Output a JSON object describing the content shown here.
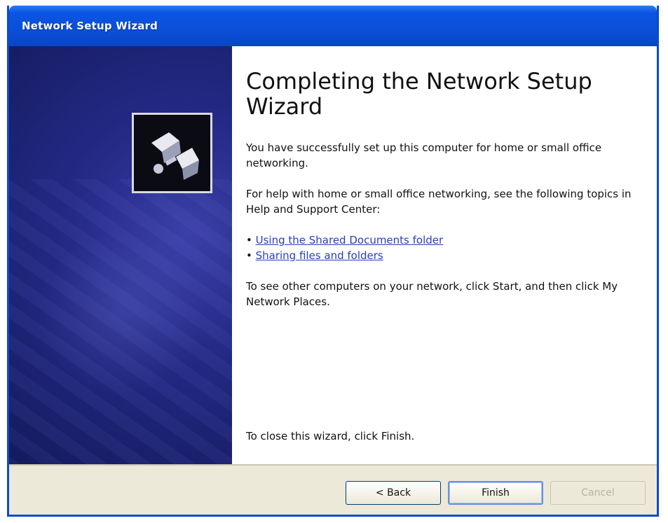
{
  "window": {
    "title": "Network Setup Wizard"
  },
  "icons": {
    "sidebar_graphic": "network-setup-wizard-icon"
  },
  "content": {
    "heading": "Completing the Network Setup Wizard",
    "para1": "You have successfully set up this computer for home or small office networking.",
    "para2": "For help with home or small office networking, see the following topics in Help and Support Center:",
    "links": [
      "Using the Shared Documents folder",
      "Sharing files and folders"
    ],
    "para3": "To see other computers on your network, click Start, and then click My Network Places.",
    "finish_note": "To close this wizard, click Finish."
  },
  "buttons": {
    "back": "< Back",
    "finish": "Finish",
    "cancel": "Cancel"
  },
  "colors": {
    "title_bar": "#0a4fd8",
    "sidebar": "#242a86",
    "link": "#2a3fb3",
    "footer": "#ece9d8"
  }
}
